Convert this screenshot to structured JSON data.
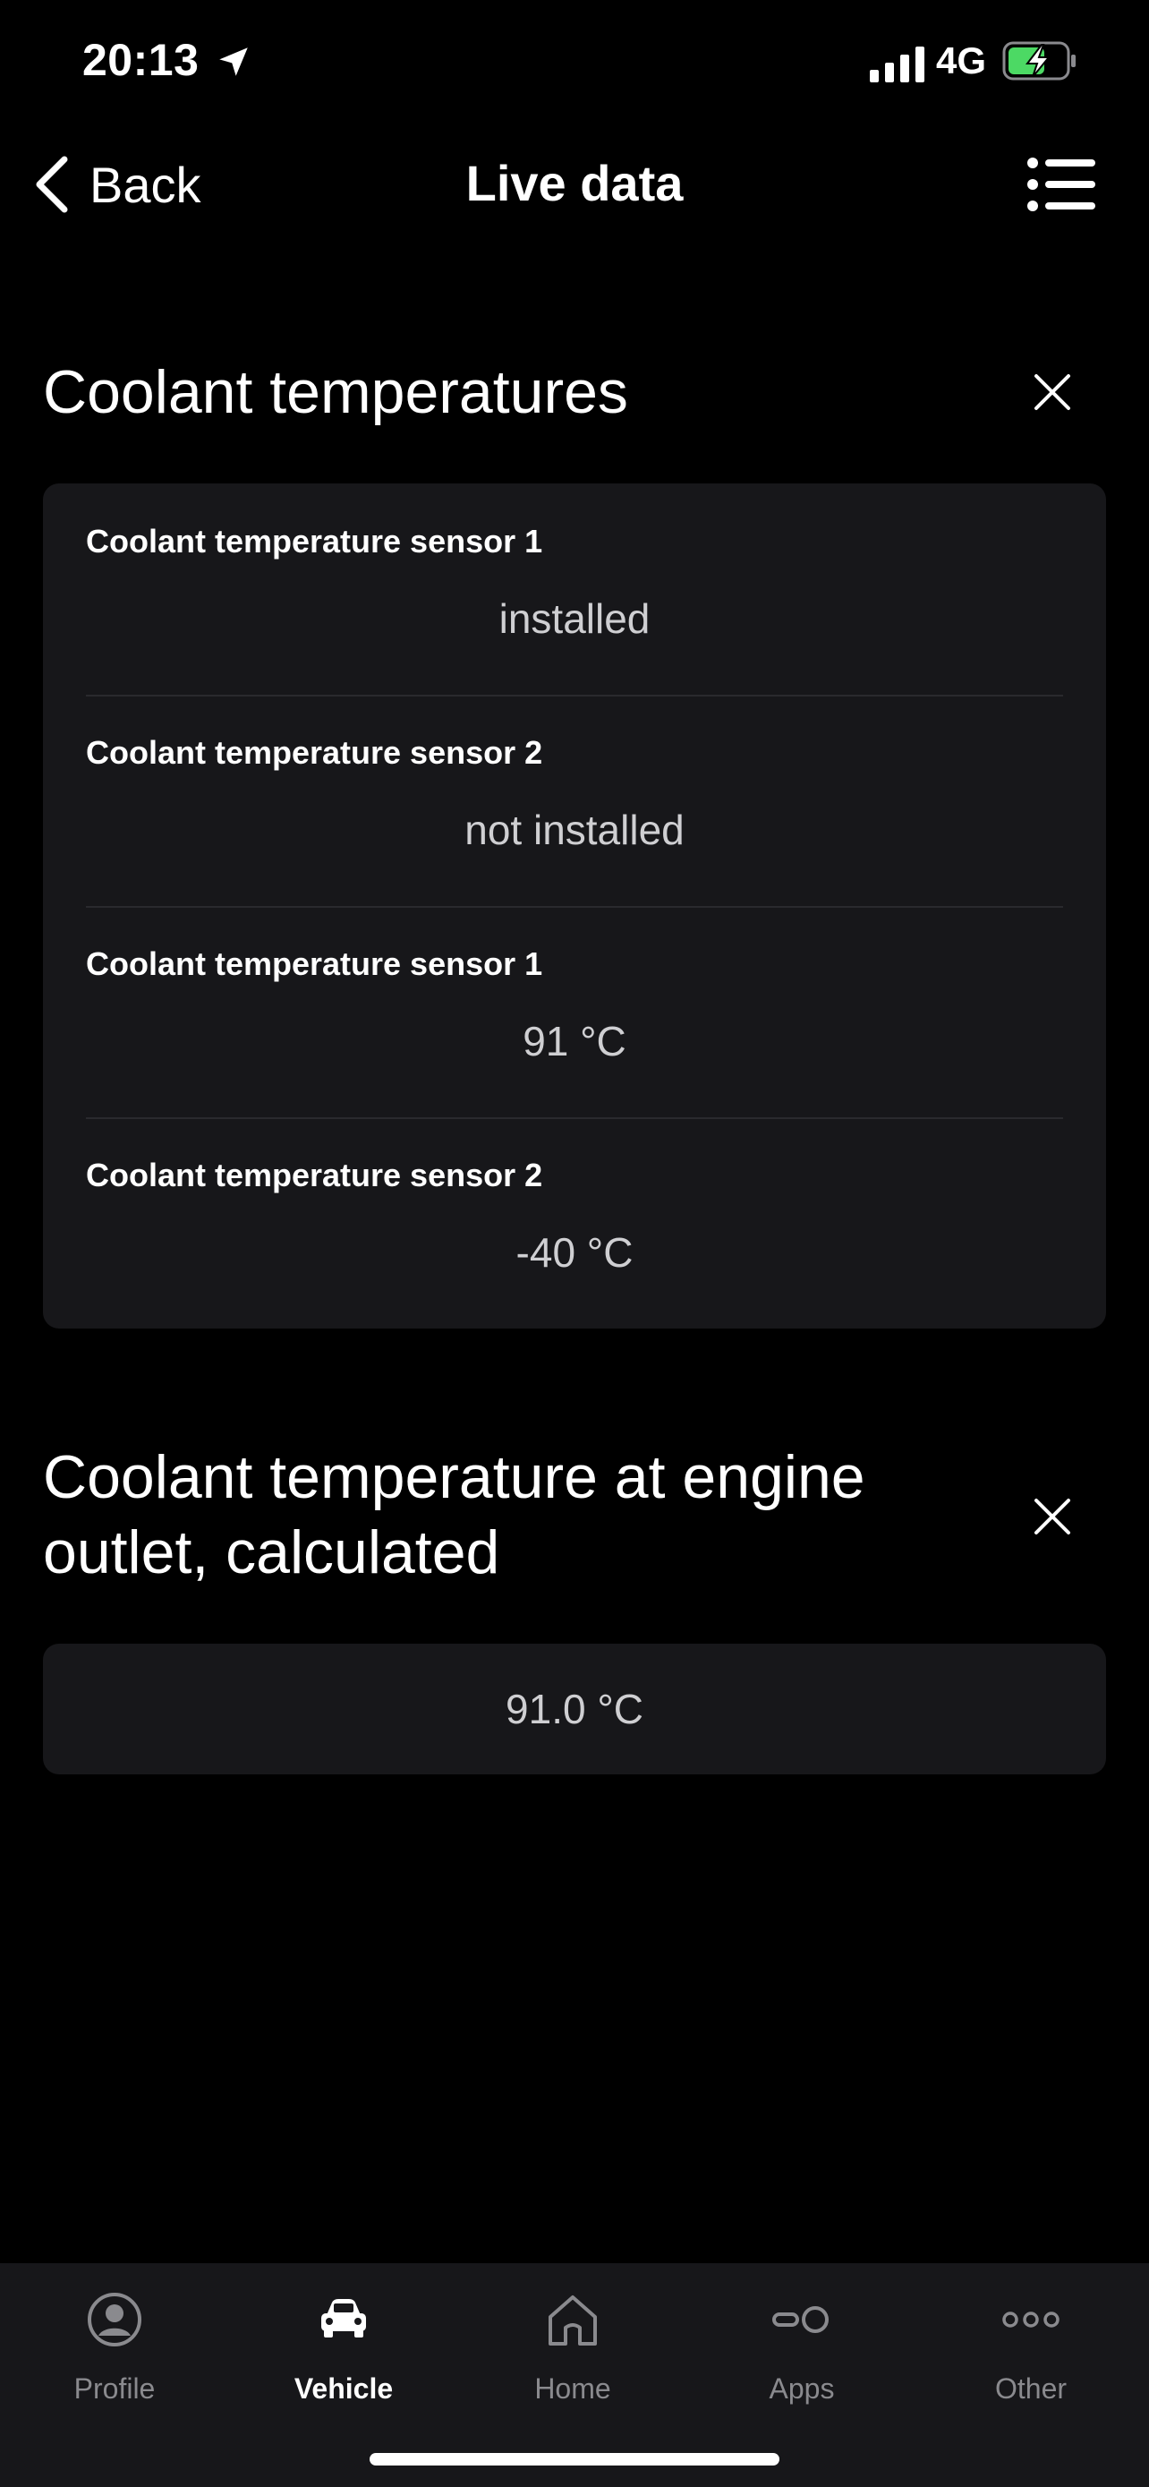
{
  "status_bar": {
    "time": "20:13",
    "network": "4G"
  },
  "nav": {
    "back_label": "Back",
    "title": "Live data"
  },
  "sections": [
    {
      "title": "Coolant temperatures",
      "rows": [
        {
          "label": "Coolant temperature sensor 1",
          "value": "installed"
        },
        {
          "label": "Coolant temperature sensor 2",
          "value": "not installed"
        },
        {
          "label": "Coolant temperature sensor 1",
          "value": "91 °C"
        },
        {
          "label": "Coolant temperature sensor 2",
          "value": "-40 °C"
        }
      ]
    },
    {
      "title": "Coolant temperature at engine outlet, calculated",
      "value": "91.0 °C"
    }
  ],
  "tabs": [
    {
      "label": "Profile",
      "icon": "profile-icon",
      "active": false
    },
    {
      "label": "Vehicle",
      "icon": "car-icon",
      "active": true
    },
    {
      "label": "Home",
      "icon": "home-icon",
      "active": false
    },
    {
      "label": "Apps",
      "icon": "apps-icon",
      "active": false
    },
    {
      "label": "Other",
      "icon": "more-icon",
      "active": false
    }
  ],
  "colors": {
    "background": "#000000",
    "card": "#17171a",
    "battery_fill": "#4cd964"
  }
}
